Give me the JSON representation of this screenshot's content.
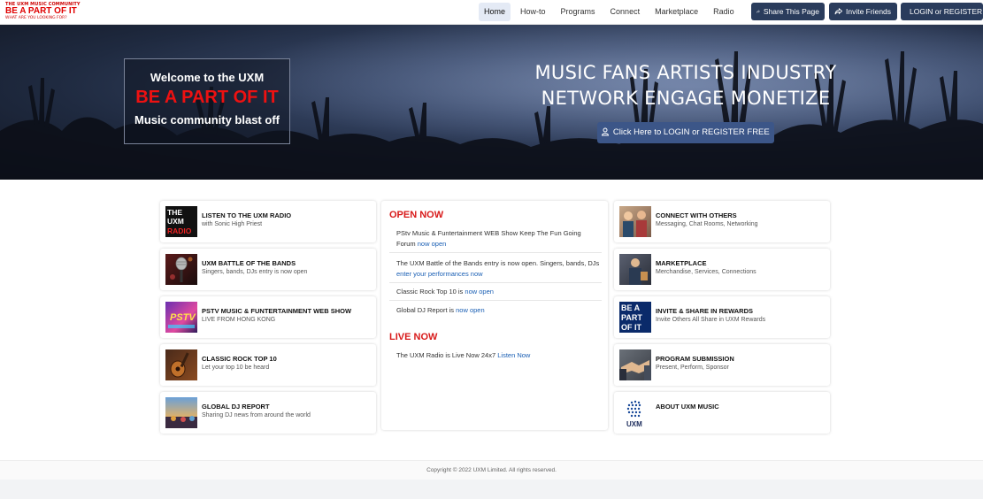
{
  "logo": {
    "line1": "THE UXM MUSIC COMMUNITY",
    "line2": "BE A PART OF IT",
    "line3": "WHAT ARE YOU LOOKING FOR?"
  },
  "nav": {
    "links": [
      "Home",
      "How-to",
      "Programs",
      "Connect",
      "Marketplace",
      "Radio"
    ],
    "share": "Share This Page",
    "invite": "Invite Friends",
    "login": "LOGIN or REGISTER"
  },
  "hero": {
    "welcome": "Welcome to the UXM",
    "tagline": "BE A PART OF IT",
    "blast": "Music community blast off",
    "headline1": "MUSIC FANS ARTISTS INDUSTRY",
    "headline2": "NETWORK ENGAGE MONETIZE",
    "cta": "Click Here to LOGIN or REGISTER FREE"
  },
  "left_cards": [
    {
      "title": "LISTEN TO THE UXM RADIO",
      "sub": "with Sonic High Priest",
      "thumb": "radio-thumb"
    },
    {
      "title": "UXM BATTLE OF THE BANDS",
      "sub": "Singers, bands, DJs entry is now open",
      "thumb": "microphone-thumb"
    },
    {
      "title": "PSTV MUSIC & FUNTERTAINMENT WEB SHOW",
      "sub": "LIVE FROM HONG KONG",
      "thumb": "pstv-thumb"
    },
    {
      "title": "CLASSIC ROCK TOP 10",
      "sub": "Let your top 10 be heard",
      "thumb": "guitar-thumb"
    },
    {
      "title": "GLOBAL DJ REPORT",
      "sub": "Sharing DJ news from around the world",
      "thumb": "dj-thumb"
    }
  ],
  "right_cards": [
    {
      "title": "CONNECT WITH OTHERS",
      "sub": "Messaging, Chat Rooms, Networking",
      "thumb": "people-thumb"
    },
    {
      "title": "MARKETPLACE",
      "sub": "Merchandise, Services, Connections",
      "thumb": "market-thumb"
    },
    {
      "title": "INVITE & SHARE IN REWARDS",
      "sub": "Invite Others All Share in UXM Rewards",
      "thumb": "bapoi-thumb",
      "badge": "BE A PART OF IT"
    },
    {
      "title": "PROGRAM SUBMISSION",
      "sub": "Present, Perform, Sponsor",
      "thumb": "handshake-thumb"
    },
    {
      "title": "ABOUT UXM MUSIC",
      "sub": "",
      "thumb": "uxm-logo-thumb",
      "badge": "UXM"
    }
  ],
  "open_now": {
    "heading": "OPEN NOW",
    "items": [
      {
        "text": "PStv Music & Funtertainment WEB Show Keep The Fun Going Forum",
        "link": "now open"
      },
      {
        "text": "The UXM Battle of the Bands entry is now open. Singers, bands, DJs",
        "link": "enter your performances now"
      },
      {
        "text": "Classic Rock Top 10 is",
        "link": "now open"
      },
      {
        "text": "Global DJ Report is",
        "link": "now open"
      }
    ]
  },
  "live_now": {
    "heading": "LIVE NOW",
    "items": [
      {
        "text": "The UXM Radio is Live Now 24x7",
        "link": "Listen Now"
      }
    ]
  },
  "footer": {
    "copyright": "Copyright © 2022 UXM Limited. All rights reserved."
  },
  "colors": {
    "nav_button": "#2a3c5c",
    "accent_red": "#d81a1a",
    "link": "#1a5fb4",
    "cta": "#3c5688"
  }
}
